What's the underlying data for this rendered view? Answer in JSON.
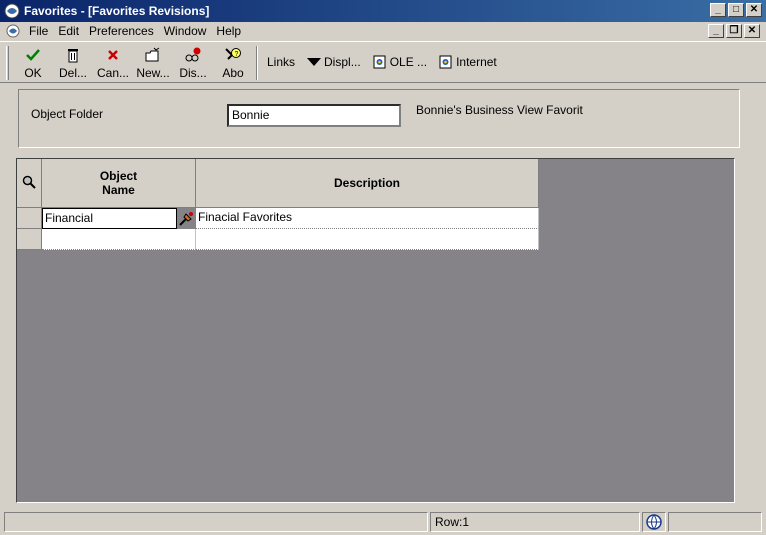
{
  "window": {
    "title": "Favorites - [Favorites Revisions]",
    "buttons": {
      "minimize": "_",
      "maximize": "□",
      "close": "✕"
    }
  },
  "menubar": {
    "items": [
      {
        "label": "File"
      },
      {
        "label": "Edit"
      },
      {
        "label": "Preferences"
      },
      {
        "label": "Window"
      },
      {
        "label": "Help"
      }
    ],
    "mdi_buttons": {
      "minimize": "_",
      "restore": "❐",
      "close": "✕"
    }
  },
  "toolbar": {
    "buttons": [
      {
        "label": "OK",
        "icon": "checkmark-icon",
        "color": "#008000"
      },
      {
        "label": "Del...",
        "icon": "trash-icon"
      },
      {
        "label": "Can...",
        "icon": "cancel-x-icon",
        "color": "#cc0000"
      },
      {
        "label": "New...",
        "icon": "new-folder-icon"
      },
      {
        "label": "Dis...",
        "icon": "display-icon"
      },
      {
        "label": "Abo",
        "icon": "about-icon"
      }
    ],
    "links": [
      {
        "label": "Links"
      },
      {
        "label": "Displ..."
      },
      {
        "label": "OLE ..."
      },
      {
        "label": "Internet"
      }
    ]
  },
  "header": {
    "object_folder_label": "Object Folder",
    "object_folder_value": "Bonnie",
    "description": "Bonnie's Business View Favorit"
  },
  "grid": {
    "columns": [
      {
        "label": "Object\nName"
      },
      {
        "label": "Description"
      }
    ],
    "rows": [
      {
        "object_name": "Financial",
        "description": "Finacial Favorites"
      },
      {
        "object_name": "",
        "description": ""
      }
    ]
  },
  "statusbar": {
    "row_text": "Row:1"
  },
  "colors": {
    "title_bar_start": "#0a246a",
    "title_bar_end": "#3a6ea5",
    "grid_background": "#858387",
    "chrome": "#d4d0c8"
  }
}
